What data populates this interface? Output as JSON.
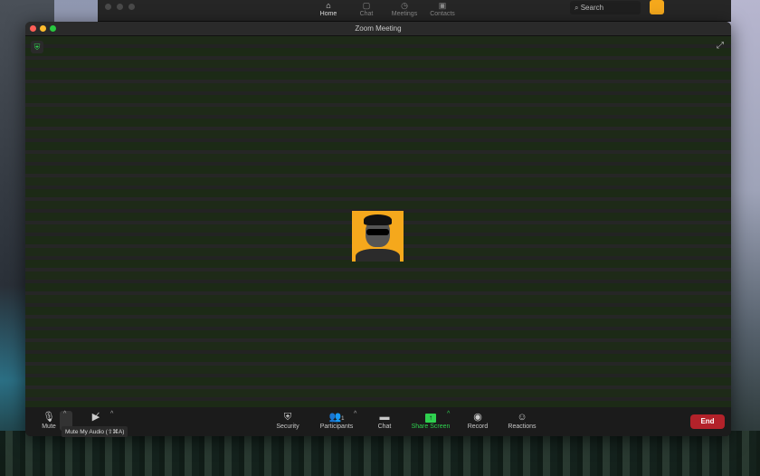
{
  "background_app": {
    "nav": [
      {
        "label": "Home",
        "icon": "home-icon",
        "active": true
      },
      {
        "label": "Chat",
        "icon": "chat-icon"
      },
      {
        "label": "Meetings",
        "icon": "clock-icon"
      },
      {
        "label": "Contacts",
        "icon": "contacts-icon"
      }
    ],
    "search_label": "Search"
  },
  "window": {
    "title": "Zoom Meeting"
  },
  "toolbar": {
    "mute": "Mute",
    "security": "Security",
    "participants": "Participants",
    "participant_count": "1",
    "chat": "Chat",
    "share_screen": "Share Screen",
    "record": "Record",
    "reactions": "Reactions",
    "end": "End"
  },
  "tooltip": "Mute My Audio (⇧⌘A)",
  "colors": {
    "share": "#2fd04f",
    "end": "#b3222a",
    "avatar_bg": "#f5a81c"
  }
}
